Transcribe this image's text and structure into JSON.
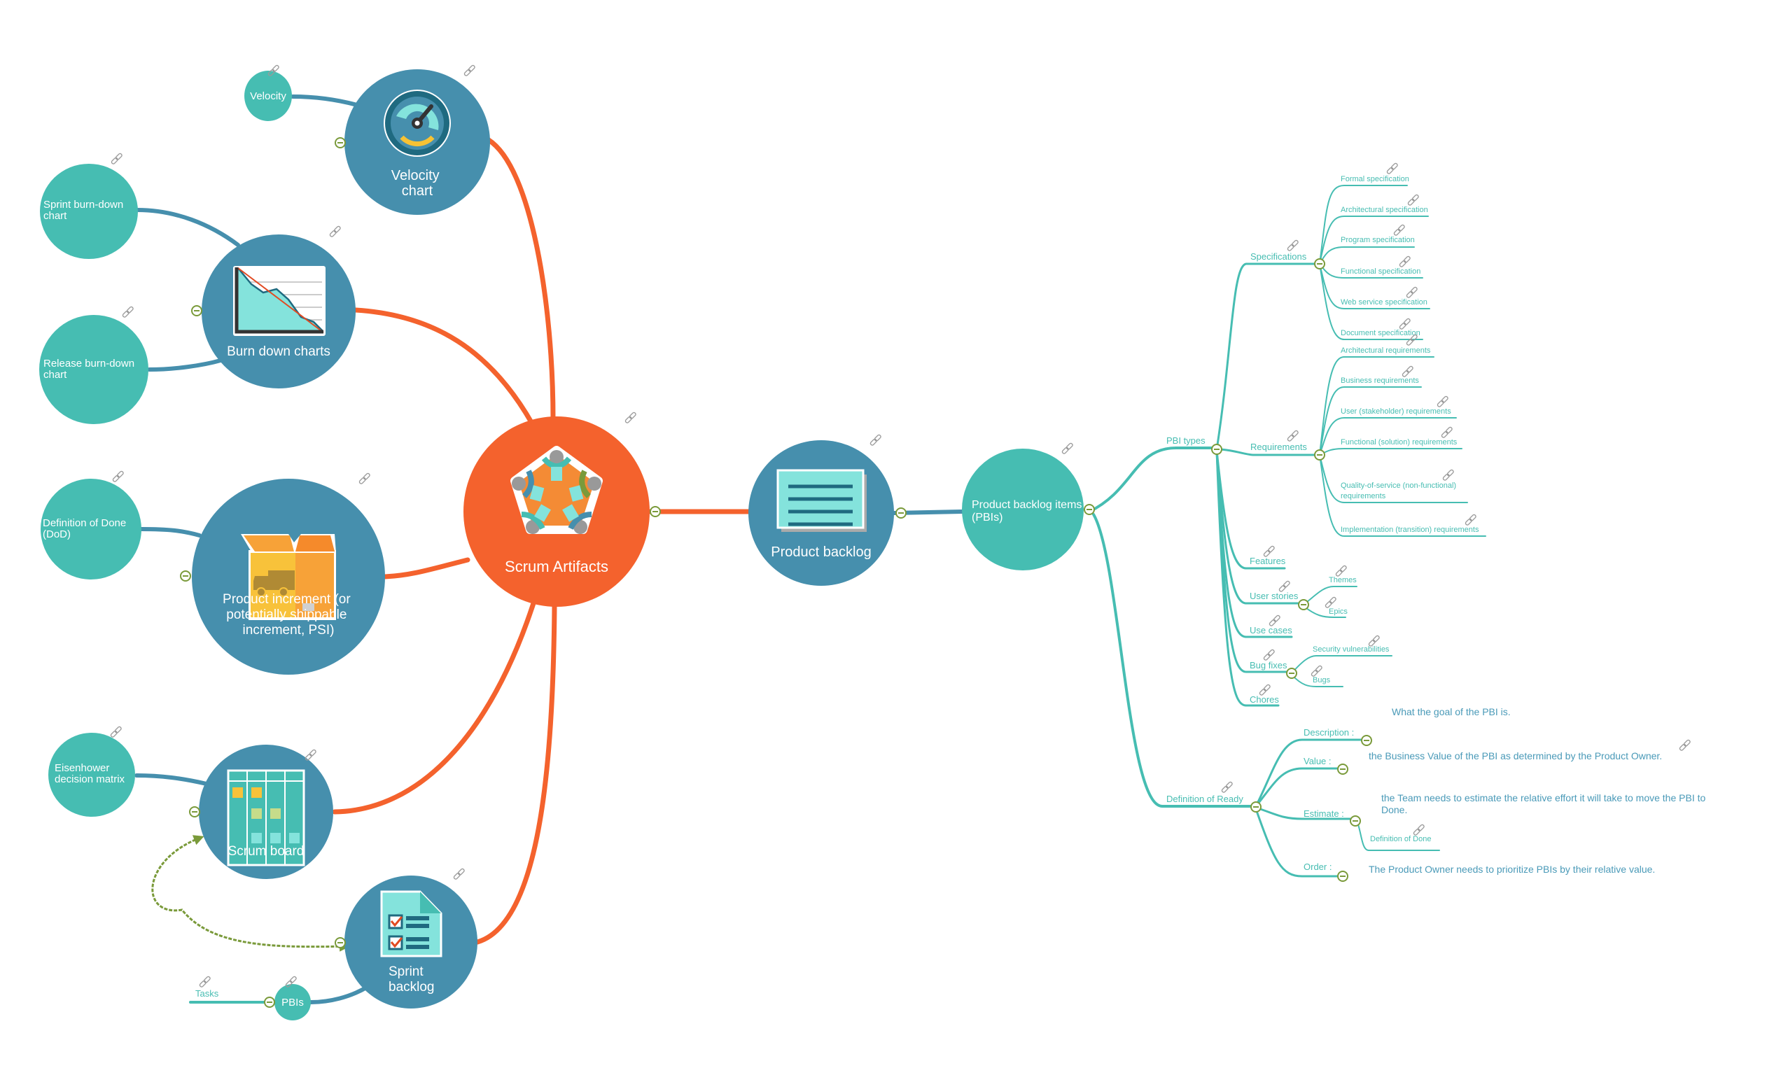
{
  "colors": {
    "root": "#f4622d",
    "main_node": "#468fad",
    "sub_node": "#46bdb2",
    "root_branch": "#f4622d",
    "main_branch": "#468fad",
    "topic_branch": "#46bdb2",
    "collapse_toggle": "#7a9a3a",
    "relation_arrow": "#7a9a3a",
    "description_text": "#4a9ab8"
  },
  "root": {
    "label": "Scrum Artifacts",
    "icon": "team-meeting-icon"
  },
  "left_nodes": {
    "velocity_chart": {
      "label_lines": [
        "Velocity",
        "chart"
      ],
      "icon": "speedometer-icon",
      "children": [
        {
          "label": "Velocity"
        }
      ]
    },
    "burn_down": {
      "label": "Burn down charts",
      "icon": "burndown-chart-icon",
      "children": [
        {
          "label_lines": [
            "Sprint burn-down",
            "chart"
          ]
        },
        {
          "label_lines": [
            "Release burn-down",
            "chart"
          ]
        }
      ]
    },
    "product_increment": {
      "label_lines": [
        "Product increment (or",
        "potentially shippable",
        "increment, PSI)"
      ],
      "icon": "box-truck-icon",
      "children": [
        {
          "label_lines": [
            "Definition of Done",
            "(DoD)"
          ]
        }
      ]
    },
    "scrum_board": {
      "label": "Scrum board",
      "icon": "kanban-board-icon",
      "children": [
        {
          "label_lines": [
            "Eisenhower",
            "decision matrix"
          ]
        }
      ]
    },
    "sprint_backlog": {
      "label_lines": [
        "Sprint",
        "backlog"
      ],
      "icon": "checklist-document-icon",
      "children": [
        {
          "label": "PBIs",
          "children": [
            {
              "label": "Tasks"
            }
          ]
        }
      ]
    }
  },
  "product_backlog": {
    "label": "Product backlog",
    "icon": "list-card-icon"
  },
  "pbi": {
    "label_lines": [
      "Product backlog items",
      "(PBIs)"
    ],
    "pbi_types": {
      "label": "PBI types",
      "specifications": {
        "label": "Specifications",
        "items": [
          "Formal specification",
          "Architectural specification",
          "Program specification",
          "Functional specification",
          "Web service specification",
          "Document specification"
        ]
      },
      "requirements": {
        "label": "Requirements",
        "items": [
          "Architectural requirements",
          "Business requirements",
          "User (stakeholder) requirements",
          "Functional (solution) requirements",
          "Quality-of-service (non-functional)",
          "requirements",
          "Implementation (transition) requirements"
        ]
      },
      "features": {
        "label": "Features"
      },
      "user_stories": {
        "label": "User stories",
        "items": [
          "Themes",
          "Epics"
        ]
      },
      "use_cases": {
        "label": "Use cases"
      },
      "bug_fixes": {
        "label": "Bug fixes",
        "items": [
          "Security vulnerabilities",
          "Bugs"
        ]
      },
      "chores": {
        "label": "Chores"
      }
    },
    "definition_of_ready": {
      "label": "Definition of Ready",
      "description": {
        "label": "Description :",
        "text": "What the goal of the PBI is."
      },
      "value": {
        "label": "Value :",
        "text": "the Business Value of the PBI as determined by the Product Owner."
      },
      "estimate": {
        "label": "Estimate :",
        "text_lines": [
          "the Team needs to estimate the relative effort it will take to move the PBI to",
          "Done."
        ],
        "child": "Definition of Done"
      },
      "order": {
        "label": "Order :",
        "text": "The Product Owner needs to prioritize PBIs by their relative value."
      }
    }
  }
}
